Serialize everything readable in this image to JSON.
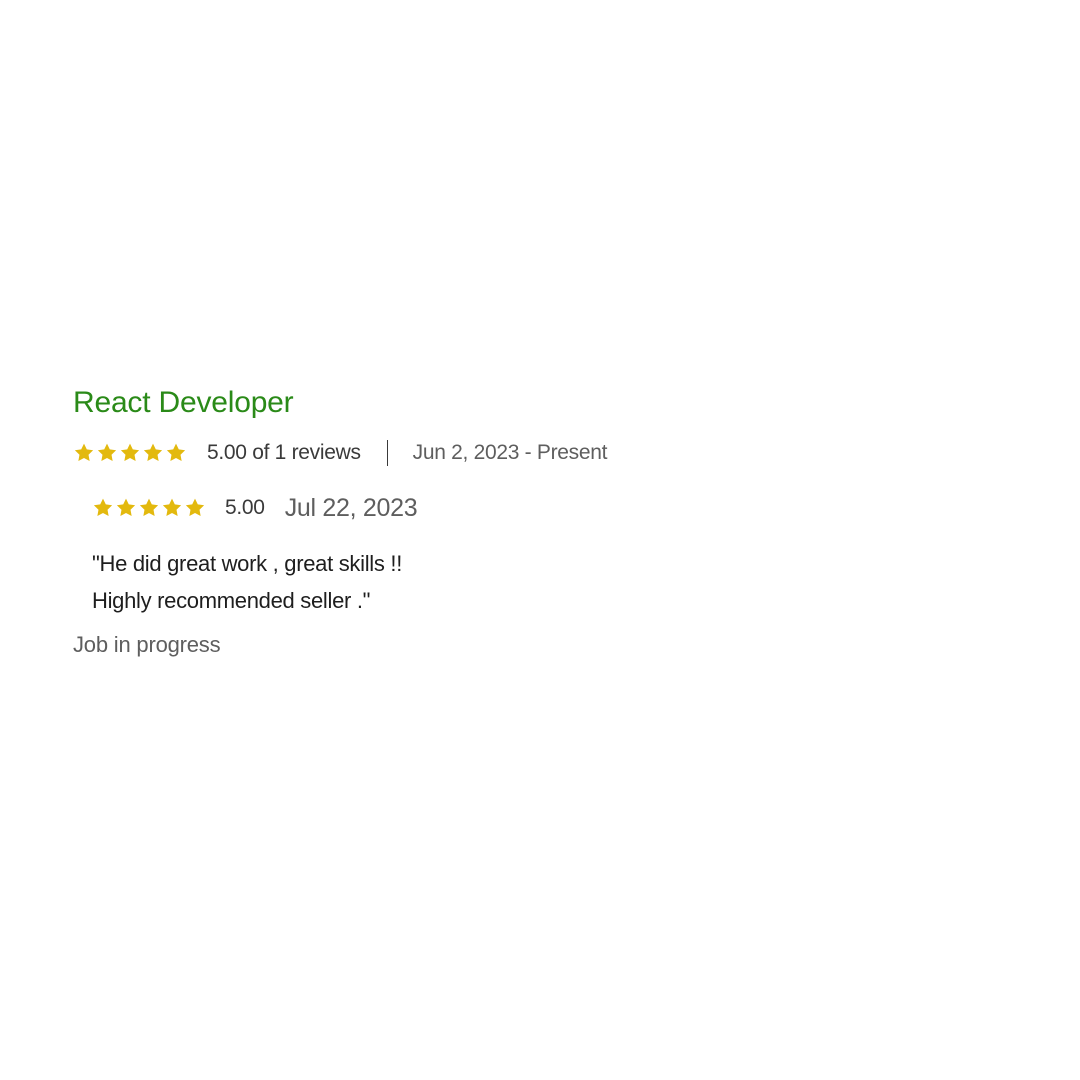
{
  "job": {
    "title": "React Developer",
    "rating": 5,
    "rating_summary": "5.00 of 1 reviews",
    "date_range": "Jun 2, 2023 - Present",
    "status": "Job in progress"
  },
  "review": {
    "rating": 5,
    "score": "5.00",
    "date": "Jul 22, 2023",
    "text_line1": "\"He did great work , great skills !!",
    "text_line2": "Highly recommended seller .\""
  },
  "icons": {
    "star": "star-icon"
  },
  "colors": {
    "title_green": "#2a8a18",
    "star_gold": "#e3b90e",
    "text_dark": "#1e1e1e",
    "text_gray": "#5e5e5e"
  }
}
